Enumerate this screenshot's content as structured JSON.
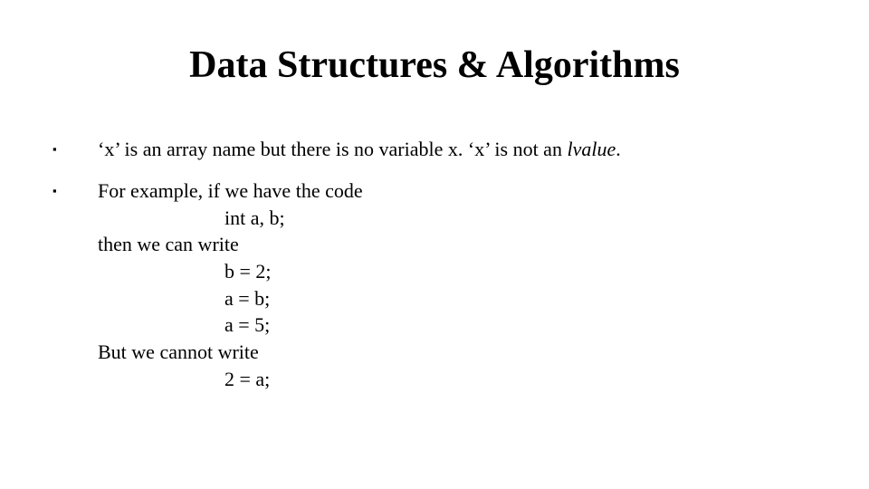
{
  "title": "Data Structures & Algorithms",
  "bullets": {
    "b1": {
      "pre": "‘x’ is an array name but there is no variable x. ‘x’ is not an ",
      "ital": "lvalue",
      "post": "."
    },
    "b2": {
      "l1": "For example, if we have the code",
      "l2": "int a, b;",
      "l3": "then we can write",
      "l4": "b = 2;",
      "l5": "a = b;",
      "l6": "a = 5;",
      "l7": "But we cannot write",
      "l8": "2 = a;"
    }
  },
  "glyphs": {
    "square": "▪"
  }
}
